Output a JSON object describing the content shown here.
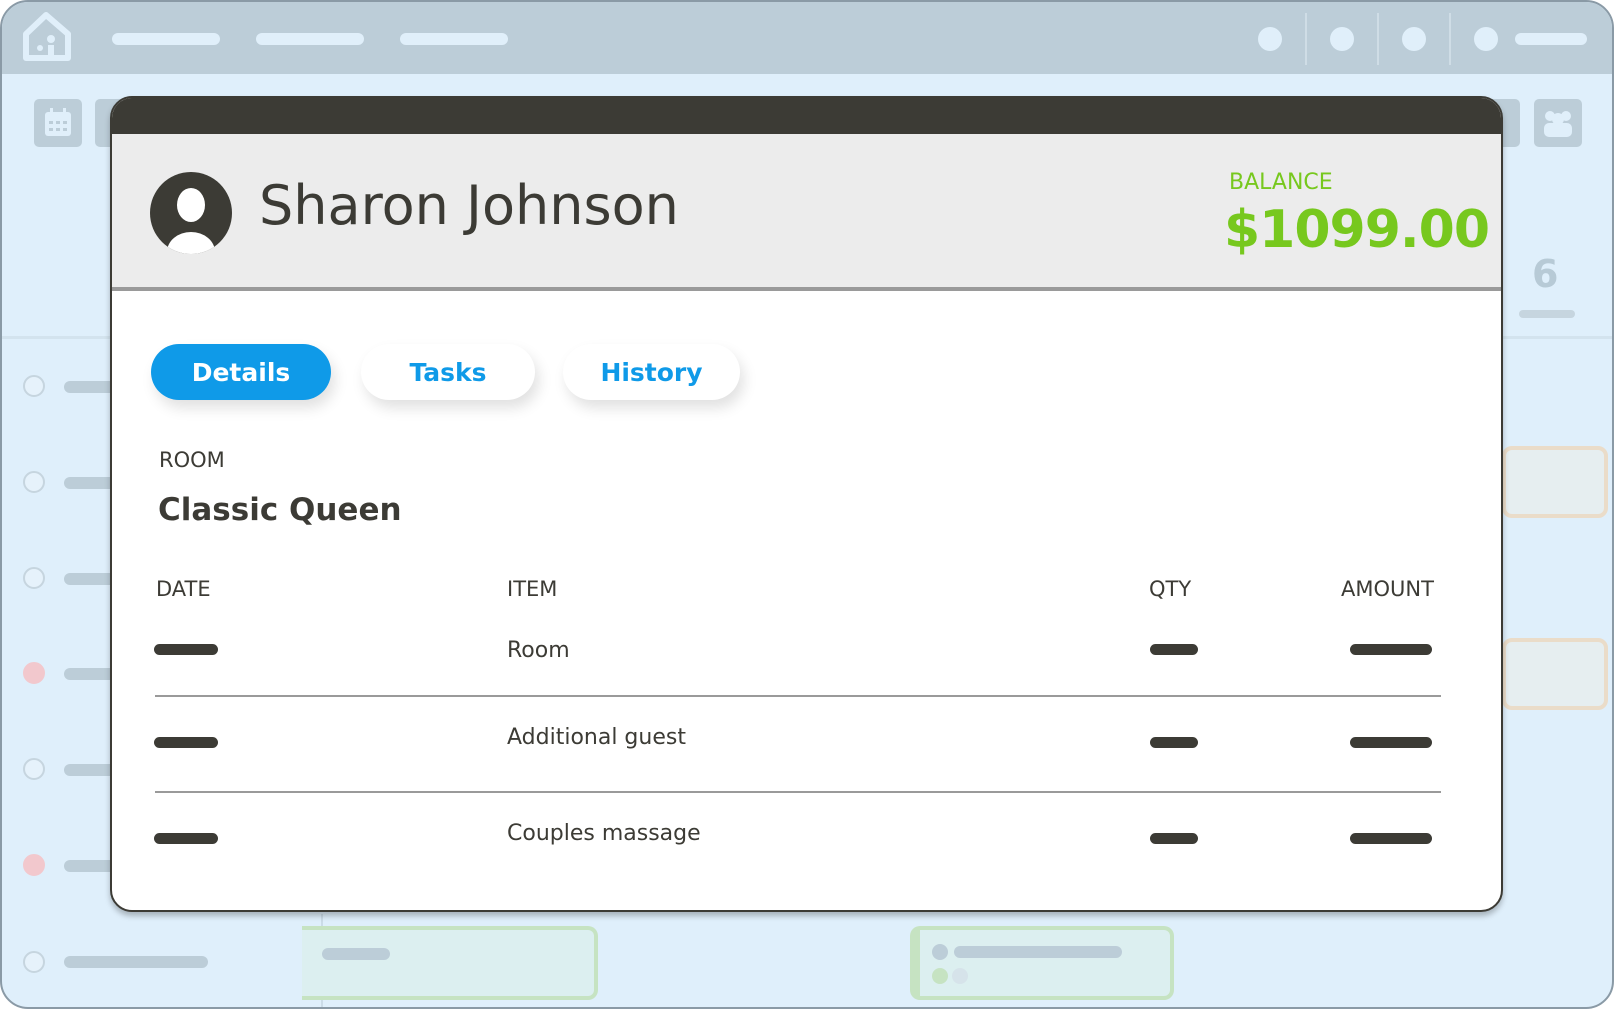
{
  "guest": {
    "name": "Sharon Johnson",
    "balance_label": "BALANCE",
    "balance": "$1099.00"
  },
  "tabs": [
    {
      "label": "Details",
      "active": true
    },
    {
      "label": "Tasks"
    },
    {
      "label": "History"
    }
  ],
  "room": {
    "label": "ROOM",
    "value": "Classic Queen"
  },
  "table": {
    "headers": [
      "DATE",
      "ITEM",
      "QTY",
      "AMOUNT"
    ],
    "rows": [
      {
        "item": "Room"
      },
      {
        "item": "Additional guest"
      },
      {
        "item": "Couples massage"
      }
    ]
  },
  "background": {
    "calendar_day": "6"
  },
  "colors": {
    "accent": "#0f9ae8",
    "balance": "#77c81e",
    "dark": "#3c3b35"
  }
}
